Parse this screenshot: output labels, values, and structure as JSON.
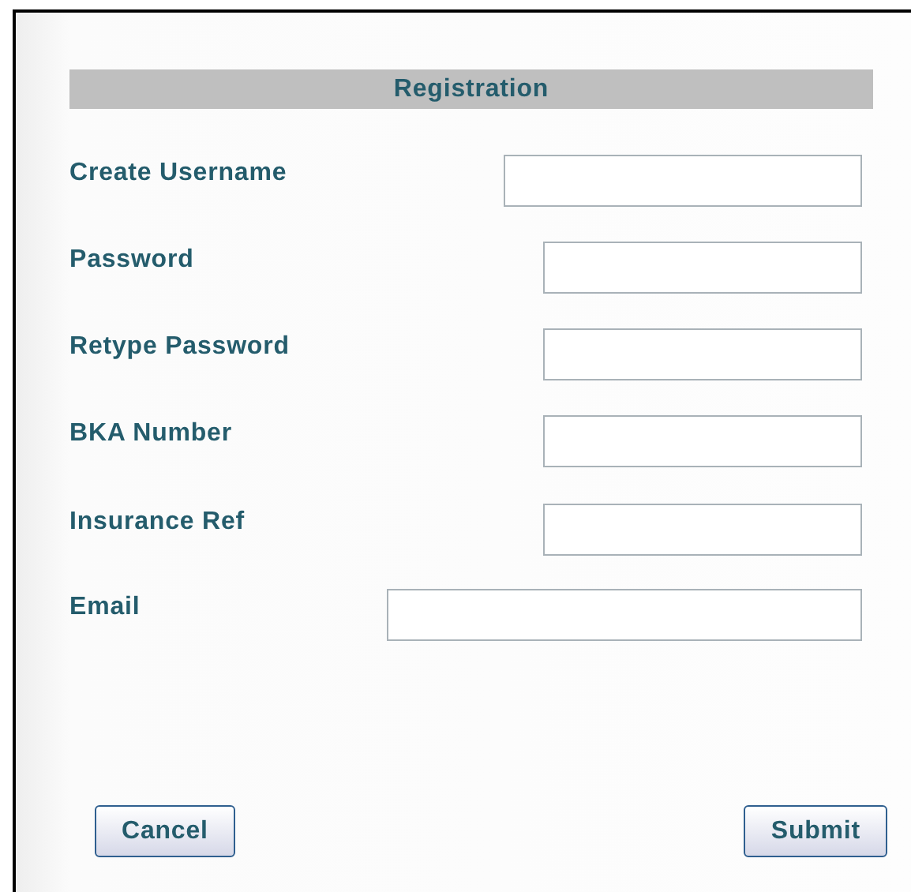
{
  "form": {
    "title": "Registration",
    "fields": [
      {
        "label": "Create Username"
      },
      {
        "label": "Password"
      },
      {
        "label": "Retype Password"
      },
      {
        "label": "BKA Number"
      },
      {
        "label": "Insurance Ref"
      },
      {
        "label": "Email"
      }
    ],
    "buttons": [
      "Cancel",
      "Submit"
    ]
  }
}
